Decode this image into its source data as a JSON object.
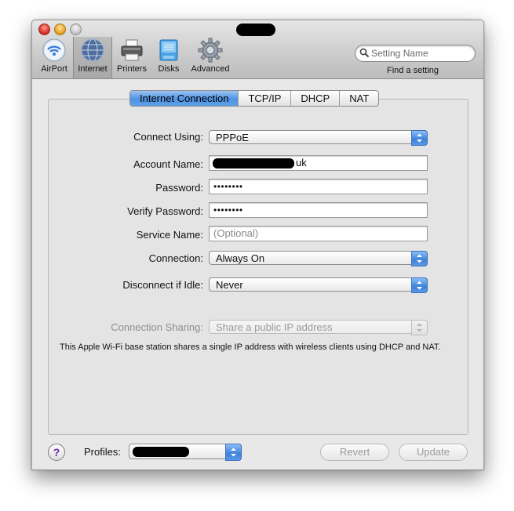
{
  "toolbar": {
    "items": [
      {
        "label": "AirPort",
        "icon": "airport-icon"
      },
      {
        "label": "Internet",
        "icon": "globe-icon"
      },
      {
        "label": "Printers",
        "icon": "printer-icon"
      },
      {
        "label": "Disks",
        "icon": "disk-icon"
      },
      {
        "label": "Advanced",
        "icon": "gear-icon"
      }
    ],
    "search_placeholder": "Setting Name",
    "find_label": "Find a setting"
  },
  "tabs": [
    "Internet Connection",
    "TCP/IP",
    "DHCP",
    "NAT"
  ],
  "form": {
    "connect_using_label": "Connect Using:",
    "connect_using_value": "PPPoE",
    "account_name_label": "Account Name:",
    "account_name_suffix": "uk",
    "password_label": "Password:",
    "password_value": "••••••••",
    "verify_password_label": "Verify Password:",
    "verify_password_value": "••••••••",
    "service_name_label": "Service Name:",
    "service_name_placeholder": "(Optional)",
    "connection_label": "Connection:",
    "connection_value": "Always On",
    "disconnect_label": "Disconnect if Idle:",
    "disconnect_value": "Never",
    "sharing_label": "Connection Sharing:",
    "sharing_value": "Share a public IP address",
    "note": "This Apple Wi-Fi base station shares a single IP address with wireless clients using DHCP and NAT."
  },
  "footer": {
    "help_glyph": "?",
    "profiles_label": "Profiles:",
    "revert_label": "Revert",
    "update_label": "Update"
  },
  "colors": {
    "accent": "#4f93e3",
    "help": "#6a2aa3"
  }
}
